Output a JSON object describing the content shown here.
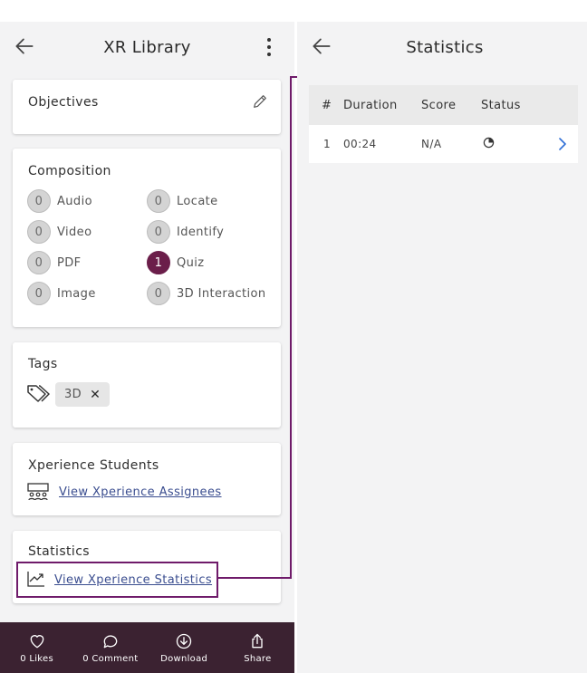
{
  "left": {
    "title": "XR Library",
    "objectives": {
      "title": "Objectives"
    },
    "composition": {
      "title": "Composition",
      "items": [
        {
          "count": "0",
          "label": "Audio",
          "active": false
        },
        {
          "count": "0",
          "label": "Locate",
          "active": false
        },
        {
          "count": "0",
          "label": "Video",
          "active": false
        },
        {
          "count": "0",
          "label": "Identify",
          "active": false
        },
        {
          "count": "0",
          "label": "PDF",
          "active": false
        },
        {
          "count": "1",
          "label": "Quiz",
          "active": true
        },
        {
          "count": "0",
          "label": "Image",
          "active": false
        },
        {
          "count": "0",
          "label": "3D Interaction",
          "active": false
        }
      ]
    },
    "tags": {
      "title": "Tags",
      "chip": "3D",
      "remove": "✕"
    },
    "students": {
      "title": "Xperience Students",
      "link": "View Xperience Assignees"
    },
    "statistics": {
      "title": "Statistics",
      "link": "View Xperience Statistics"
    },
    "bottom_nav": [
      {
        "label": "0 Likes",
        "icon": "heart-icon"
      },
      {
        "label": "0 Comment",
        "icon": "comment-icon"
      },
      {
        "label": "Download",
        "icon": "download-icon"
      },
      {
        "label": "Share",
        "icon": "share-icon"
      }
    ]
  },
  "right": {
    "title": "Statistics",
    "columns": [
      "#",
      "Duration",
      "Score",
      "Status"
    ],
    "rows": [
      {
        "num": "1",
        "duration": "00:24",
        "score": "N/A",
        "status_icon": "pie-progress-icon"
      }
    ]
  },
  "colors": {
    "accent": "#6b1e4a",
    "nav_bg": "#3b2231",
    "link": "#3a4d8f",
    "highlight": "#6f1b6a"
  }
}
